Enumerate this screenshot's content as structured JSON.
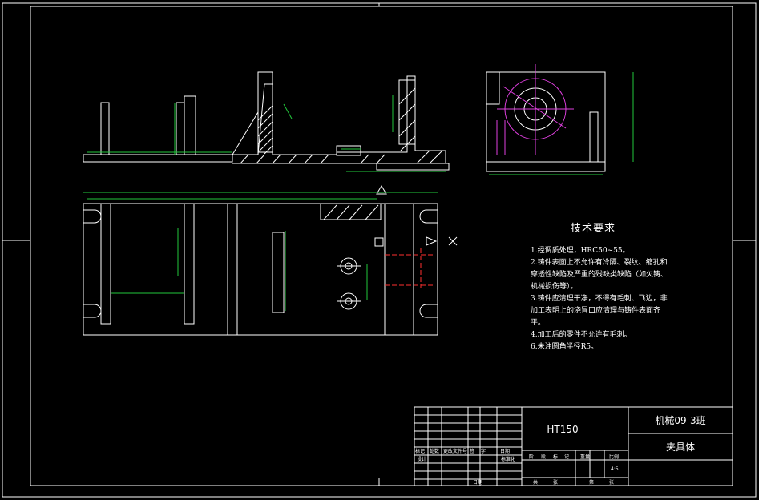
{
  "technical_requirements": {
    "title": "技术要求",
    "items": [
      "1.经调质处理，HRC50~55。",
      "2.铸件表面上不允许有冷隔、裂纹、缩孔和穿透性缺陷及严重的残缺类缺陷（如欠铸、机械损伤等）。",
      "3.铸件应清理干净，不得有毛刺、飞边，非加工表明上的浇冒口应清理与铸件表面齐平。",
      "4.加工后的零件不允许有毛刺。",
      "6.未注圆角半径R5。"
    ]
  },
  "title_block": {
    "material": "HT150",
    "class": "机械09-3班",
    "part_name": "夹具体",
    "row_labels_1": [
      "标记",
      "处数",
      "更改文件号",
      "签",
      "字",
      "日期"
    ],
    "row_labels_2": [
      "设计",
      "标准化"
    ],
    "row_labels_3": [
      "日期"
    ],
    "stage_headers": [
      "阶",
      "段",
      "标",
      "记",
      "重量",
      "比例"
    ],
    "scale": "4:5",
    "sheet_labels": [
      "共",
      "张",
      "第",
      "张"
    ]
  },
  "colors": {
    "background": "#000000",
    "lines": "#ffffff",
    "dimensions": "#22c83c",
    "centerlines": "#e040e0",
    "hidden": "#ff3030"
  }
}
